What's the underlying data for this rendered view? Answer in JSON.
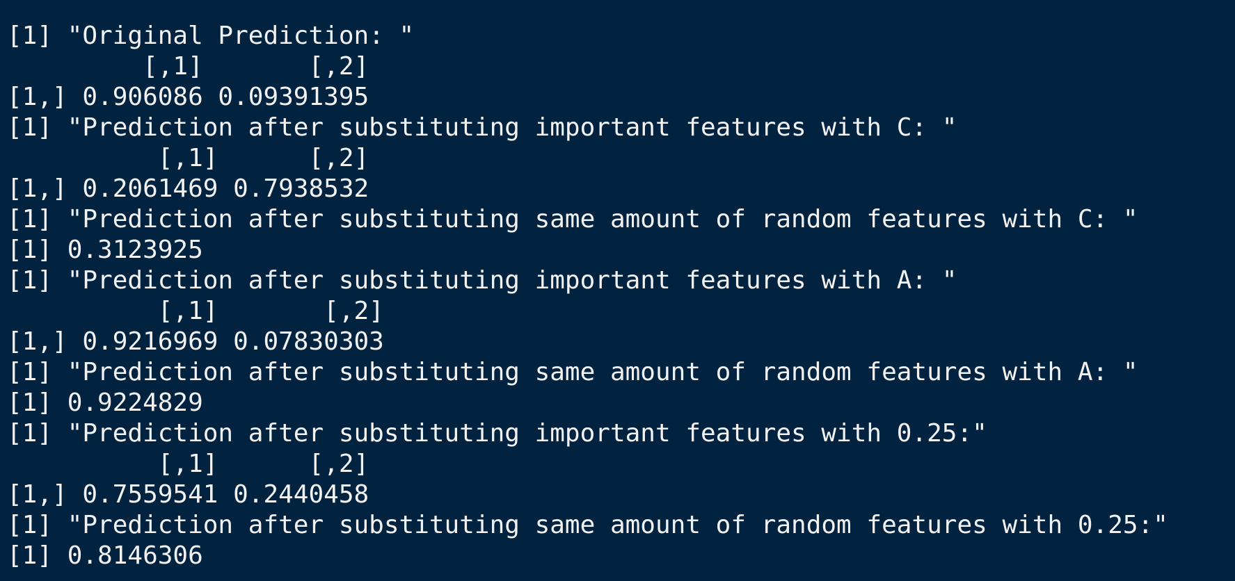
{
  "console": {
    "lines": [
      "[1] \"Original Prediction: \"",
      "         [,1]       [,2]",
      "[1,] 0.906086 0.09391395",
      "[1] \"Prediction after substituting important features with C: \"",
      "          [,1]      [,2]",
      "[1,] 0.2061469 0.7938532",
      "[1] \"Prediction after substituting same amount of random features with C: \"",
      "[1] 0.3123925",
      "[1] \"Prediction after substituting important features with A: \"",
      "          [,1]       [,2]",
      "[1,] 0.9216969 0.07830303",
      "[1] \"Prediction after substituting same amount of random features with A: \"",
      "[1] 0.9224829",
      "[1] \"Prediction after substituting important features with 0.25:\"",
      "          [,1]      [,2]",
      "[1,] 0.7559541 0.2440458",
      "[1] \"Prediction after substituting same amount of random features with 0.25:\"",
      "[1] 0.8146306"
    ]
  }
}
